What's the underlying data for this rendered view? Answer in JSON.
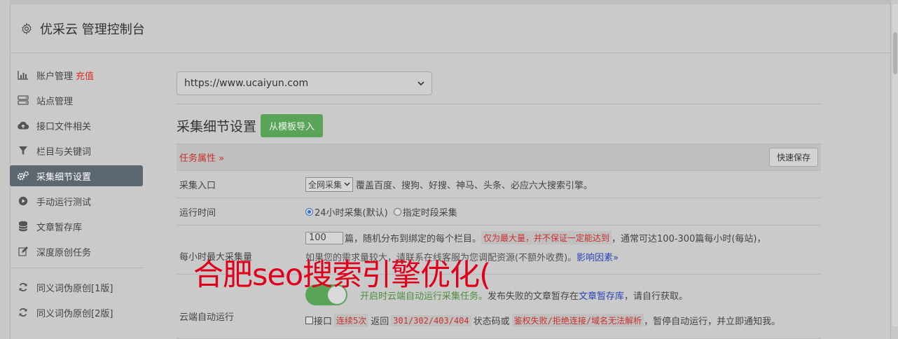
{
  "header": {
    "title": "优采云 管理控制台"
  },
  "sidebar": {
    "items": [
      {
        "label": "账户管理",
        "extra": "充值",
        "icon": "bar-chart-icon"
      },
      {
        "label": "站点管理",
        "icon": "server-icon"
      },
      {
        "label": "接口文件相关",
        "icon": "cloud-upload-icon"
      },
      {
        "label": "栏目与关键词",
        "icon": "filter-icon"
      },
      {
        "label": "采集细节设置",
        "icon": "gears-icon",
        "active": true
      },
      {
        "label": "手动运行测试",
        "icon": "play-circle-icon"
      },
      {
        "label": "文章暂存库",
        "icon": "database-icon"
      },
      {
        "label": "深度原创任务",
        "icon": "edit-icon"
      }
    ],
    "extra_items": [
      {
        "label": "同义词伪原创[1版]",
        "icon": "refresh-icon"
      },
      {
        "label": "同义词伪原创[2版]",
        "icon": "refresh-icon"
      }
    ]
  },
  "main": {
    "url_select": {
      "value": "https://www.ucaiyun.com"
    },
    "section_title": "采集细节设置",
    "import_button": "从模板导入",
    "task_attr": "任务属性 »",
    "quick_save": "快速保存",
    "rows": {
      "entry": {
        "label": "采集入口",
        "select_value": "全网采集",
        "desc": "覆盖百度、搜狗、好搜、神马、头条、必应六大搜索引擎。"
      },
      "runtime": {
        "label": "运行时间",
        "opt1": "24小时采集(默认)",
        "opt2": "指定时段采集"
      },
      "max": {
        "label": "每小时最大采集量",
        "value": "100",
        "t1": "篇，随机分布到绑定的每个栏目。",
        "note": "仅为最大量，并不保证一定能达到",
        "t2": "，通常可达100-300篇每小时(每站)，",
        "t3": "如果您的需求量较大，请联系在线客服为您调配资源(不额外收费)。",
        "link": "影响因素»"
      },
      "cloud": {
        "label": "云端自动运行",
        "t1": "开启时云端自动运行采集任务。",
        "t2": "发布失败的文章暂存在",
        "link": "文章暂存库",
        "t3": "，请自行获取。",
        "chk": "接口",
        "code1": "连续5次",
        "t4": "返回",
        "code2": "301/302/403/404",
        "t5": "状态码或",
        "code3": "鉴权失败/拒绝连接/域名无法解析",
        "t6": "，暂停自动运行，并立即通知我。"
      }
    }
  },
  "watermark": "合肥seo搜索引擎优化(",
  "colors": {
    "active_nav": "#5d6770",
    "green": "#5aa45a",
    "red": "#c9302c",
    "link": "#2a43b5"
  }
}
